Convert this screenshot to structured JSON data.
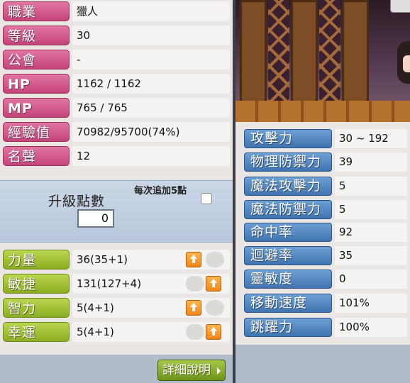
{
  "info": [
    {
      "label": "職業",
      "value": "獵人"
    },
    {
      "label": "等級",
      "value": "30"
    },
    {
      "label": "公會",
      "value": "-"
    },
    {
      "label": "HP",
      "value": "1162 / 1162"
    },
    {
      "label": "MP",
      "value": "765 / 765"
    },
    {
      "label": "經驗值",
      "value": "70982/95700(74%)"
    },
    {
      "label": "名聲",
      "value": "12"
    }
  ],
  "points": {
    "label": "升級點數",
    "value": "0",
    "auto_label": "每次追加5點",
    "auto_checked": false
  },
  "abilities": [
    {
      "label": "力量",
      "value": "36(35+1)"
    },
    {
      "label": "敏捷",
      "value": "131(127+4)"
    },
    {
      "label": "智力",
      "value": "5(4+1)"
    },
    {
      "label": "幸運",
      "value": "5(4+1)"
    }
  ],
  "detail_button": "詳細說明",
  "stats": [
    {
      "label": "攻擊力",
      "value": "30 ~ 192"
    },
    {
      "label": "物理防禦力",
      "value": "39"
    },
    {
      "label": "魔法攻擊力",
      "value": "5"
    },
    {
      "label": "魔法防禦力",
      "value": "5"
    },
    {
      "label": "命中率",
      "value": "92"
    },
    {
      "label": "迴避率",
      "value": "35"
    },
    {
      "label": "靈敏度",
      "value": "0"
    },
    {
      "label": "移動速度",
      "value": "101%"
    },
    {
      "label": "跳躍力",
      "value": "100%"
    }
  ],
  "colors": {
    "info_label": "#cf5588",
    "ability_label": "#9fc035",
    "stat_label": "#5189c4",
    "arrow_button": "#f5941f"
  }
}
